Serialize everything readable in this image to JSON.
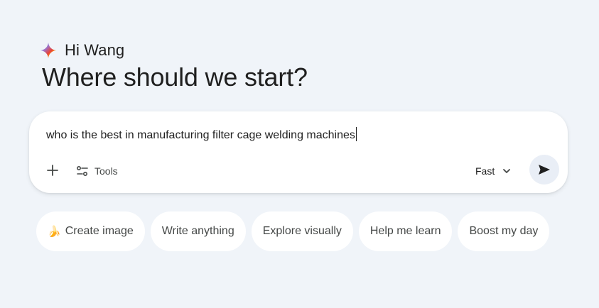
{
  "greeting": {
    "hi": "Hi Wang",
    "headline": "Where should we start?"
  },
  "composer": {
    "value": "who is the best in manufacturing filter cage welding machines",
    "tools_label": "Tools",
    "mode_label": "Fast",
    "icons": {
      "add": "plus-icon",
      "tools": "tools-sliders-icon",
      "mode": "chevron-down-icon",
      "send": "send-icon"
    }
  },
  "chips": [
    {
      "label": "Create image",
      "icon": "🍌"
    },
    {
      "label": "Write anything"
    },
    {
      "label": "Explore visually"
    },
    {
      "label": "Help me learn"
    },
    {
      "label": "Boost my day"
    }
  ],
  "colors": {
    "background": "#f0f4f9",
    "surface": "#ffffff",
    "text": "#1f1f1f",
    "muted": "#444746",
    "send_bg": "#e9eef6"
  }
}
